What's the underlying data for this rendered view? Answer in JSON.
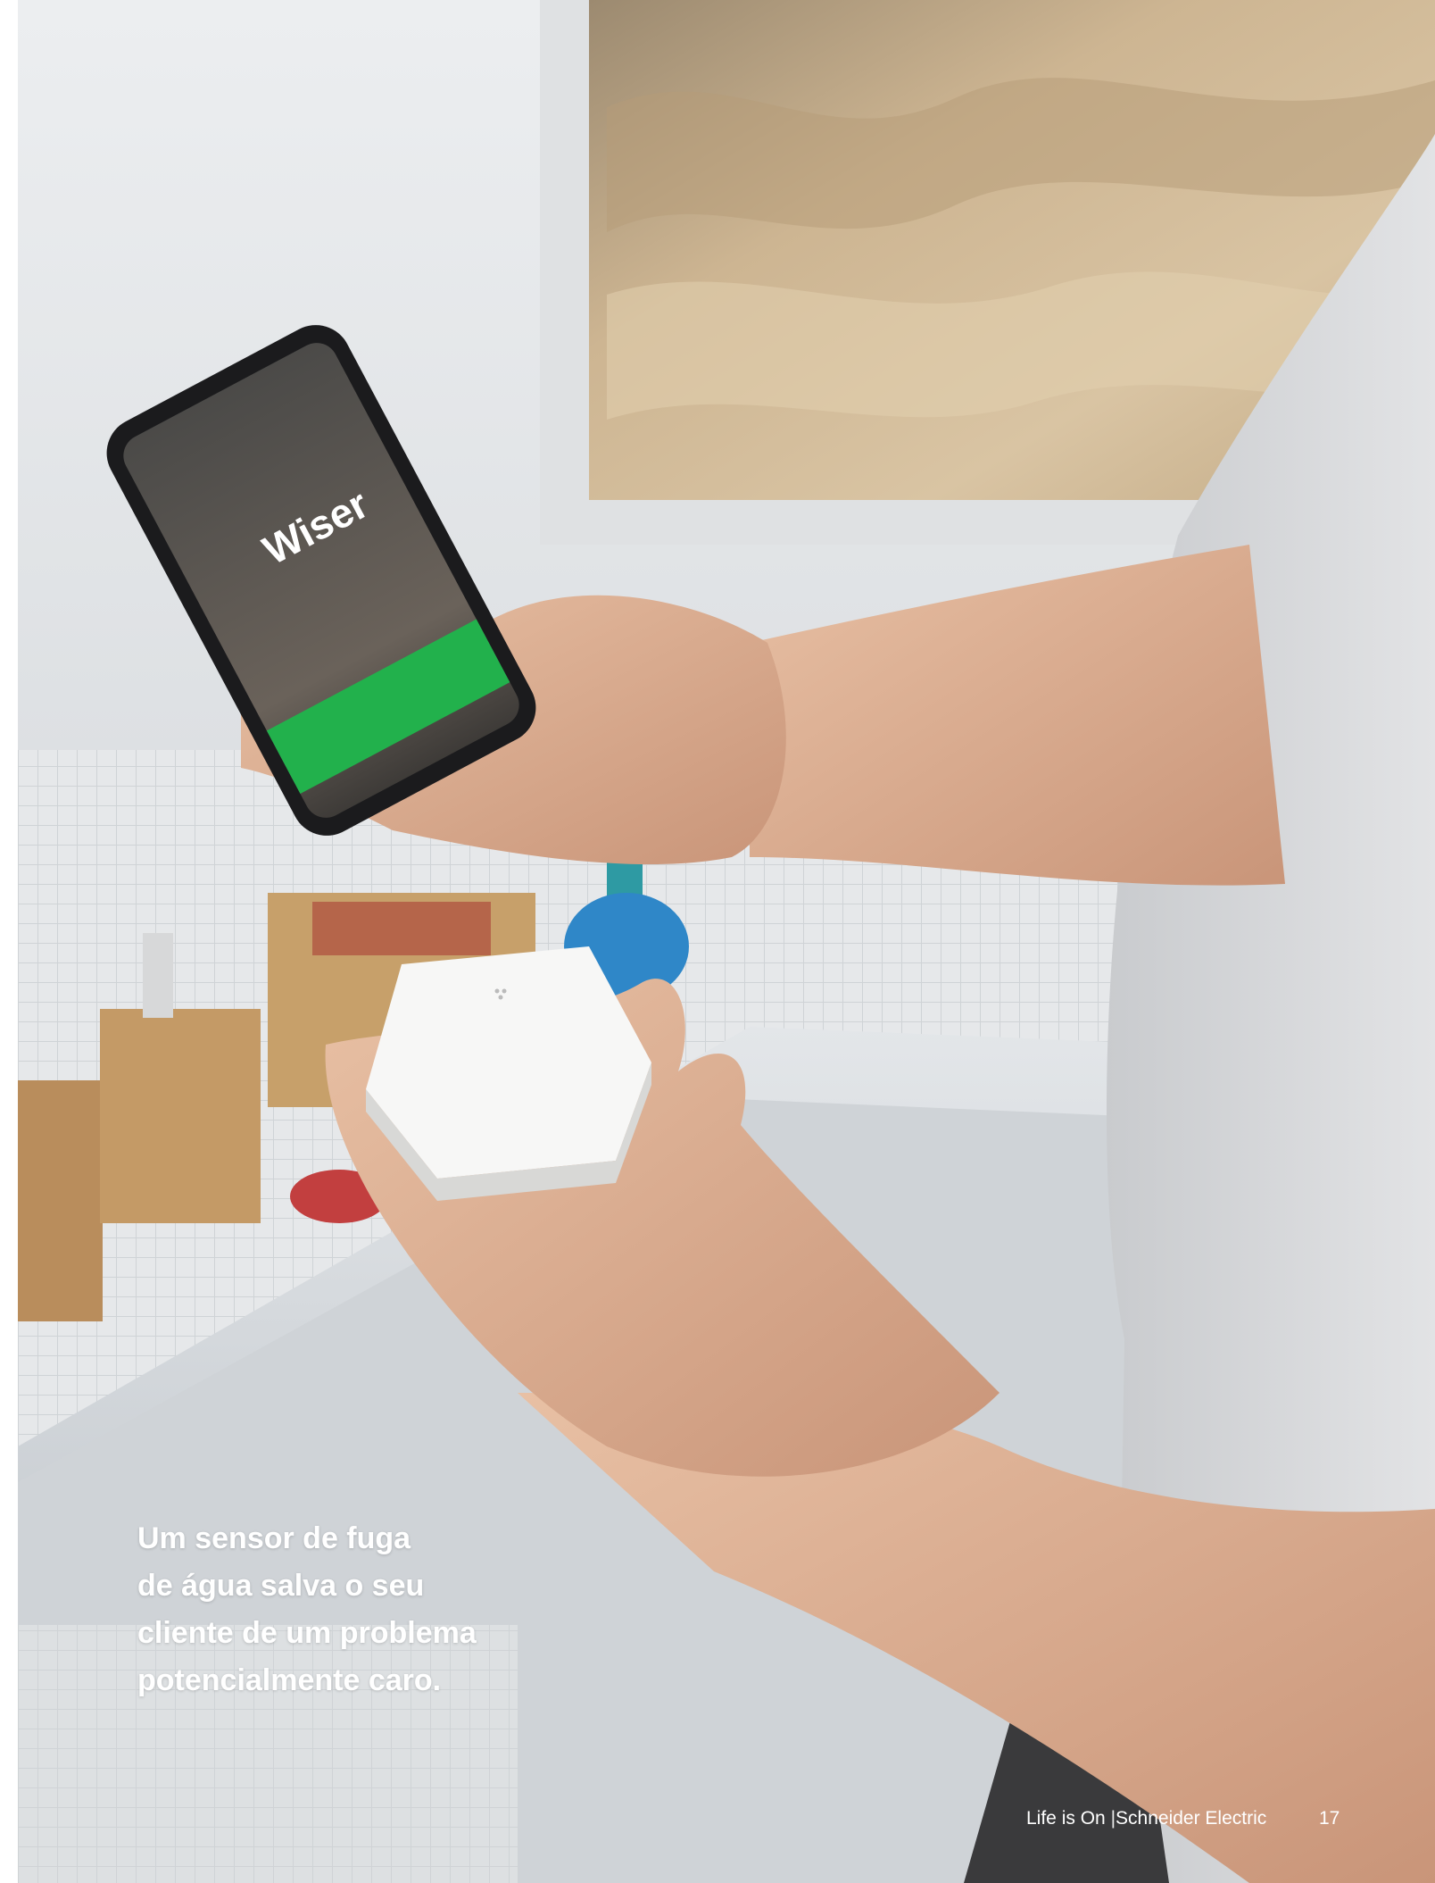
{
  "photo": {
    "description_icon": "photo-scene",
    "phone_screen_logo": "Wiser"
  },
  "caption": {
    "lines": [
      "Um sensor de fuga",
      "de água salva o seu",
      "cliente de um problema",
      "potencialmente caro."
    ]
  },
  "footer": {
    "brand_left": "Life is On",
    "separator": "|",
    "brand_right": "Schneider Electric",
    "page_number": "17"
  },
  "colors": {
    "caption_text": "#ffffff",
    "phone_green": "#22b14c",
    "shirt_grey": "#d8d9db"
  }
}
